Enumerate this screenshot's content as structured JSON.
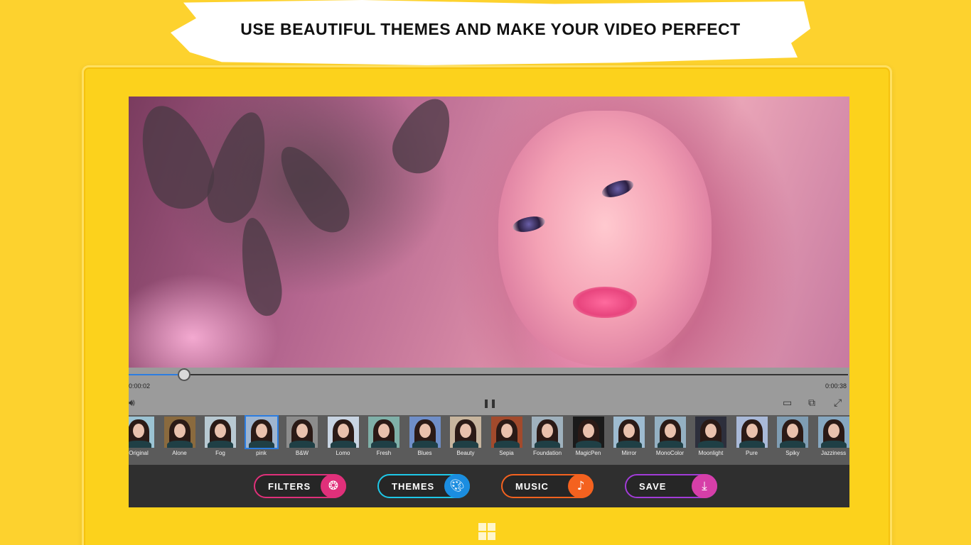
{
  "headline": "USE BEAUTIFUL THEMES AND MAKE YOUR VIDEO PERFECT",
  "player": {
    "elapsed": "0:00:02",
    "duration": "0:00:38",
    "progress_fraction": 0.077
  },
  "filters": [
    {
      "label": "Original"
    },
    {
      "label": "Alone"
    },
    {
      "label": "Fog"
    },
    {
      "label": "pink"
    },
    {
      "label": "B&W"
    },
    {
      "label": "Lomo"
    },
    {
      "label": "Fresh"
    },
    {
      "label": "Blues"
    },
    {
      "label": "Beauty"
    },
    {
      "label": "Sepia"
    },
    {
      "label": "Foundation"
    },
    {
      "label": "MagicPen"
    },
    {
      "label": "Mirror"
    },
    {
      "label": "MonoColor"
    },
    {
      "label": "Moonlight"
    },
    {
      "label": "Pure"
    },
    {
      "label": "Spiky"
    },
    {
      "label": "Jazziness"
    }
  ],
  "selected_filter": "pink",
  "buttons": {
    "filters": "FILTERS",
    "themes": "THEMES",
    "music": "MUSIC",
    "save": "SAVE"
  },
  "colors": {
    "background": "#fdd22e",
    "accent_blue": "#2c7de0",
    "filters_pink": "#e0307a",
    "themes_cyan": "#1ec8e8",
    "music_orange": "#f4621f",
    "save_purple": "#a23cd8"
  }
}
